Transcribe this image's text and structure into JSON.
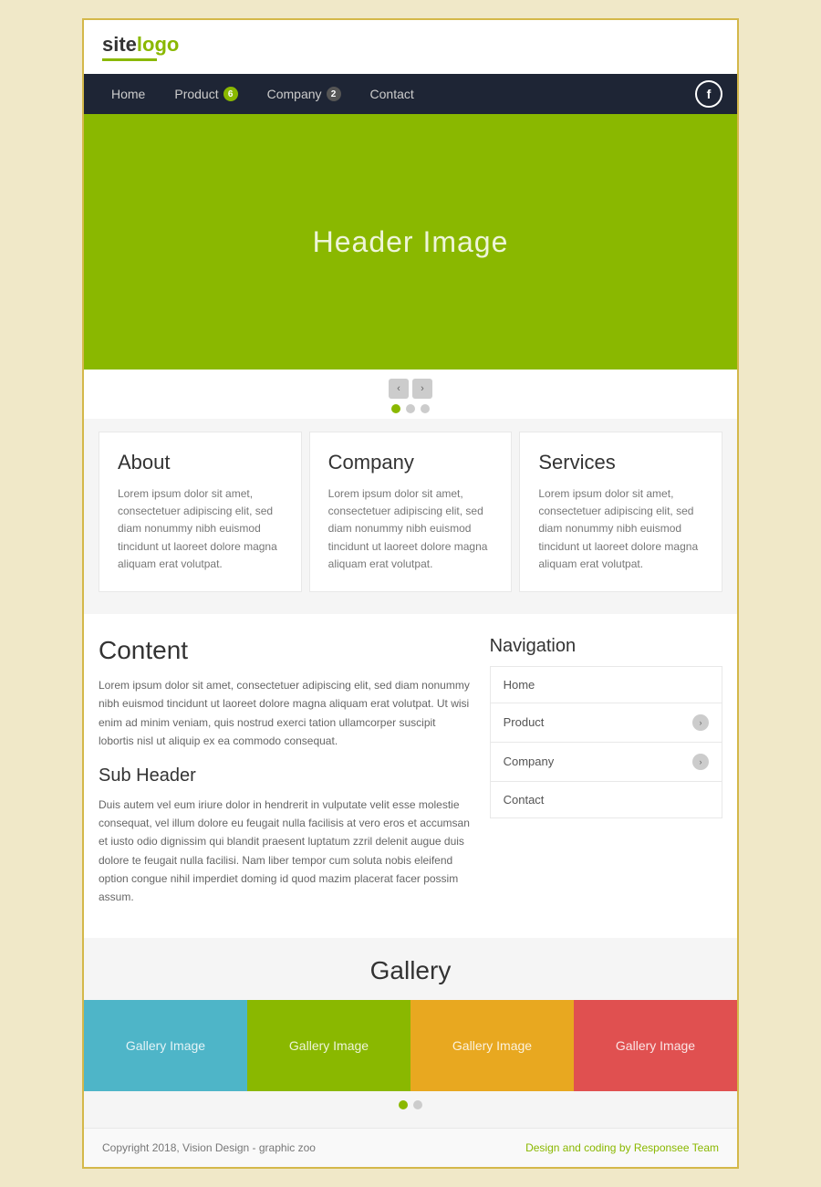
{
  "logo": {
    "text_site": "site",
    "text_logo": "logo",
    "underline": true
  },
  "nav": {
    "items": [
      {
        "label": "Home",
        "badge": null
      },
      {
        "label": "Product",
        "badge": "6"
      },
      {
        "label": "Company",
        "badge": "2"
      },
      {
        "label": "Contact",
        "badge": null
      }
    ],
    "facebook_icon": "f"
  },
  "hero": {
    "title": "Header Image"
  },
  "carousel": {
    "prev_label": "‹",
    "next_label": "›",
    "dots": [
      true,
      false,
      false
    ]
  },
  "cards": [
    {
      "title": "About",
      "body": "Lorem ipsum dolor sit amet, consectetuer adipiscing elit, sed diam nonummy nibh euismod tincidunt ut laoreet dolore magna aliquam erat volutpat."
    },
    {
      "title": "Company",
      "body": "Lorem ipsum dolor sit amet, consectetuer adipiscing elit, sed diam nonummy nibh euismod tincidunt ut laoreet dolore magna aliquam erat volutpat."
    },
    {
      "title": "Services",
      "body": "Lorem ipsum dolor sit amet, consectetuer adipiscing elit, sed diam nonummy nibh euismod tincidunt ut laoreet dolore magna aliquam erat volutpat."
    }
  ],
  "content": {
    "title": "Content",
    "body": "Lorem ipsum dolor sit amet, consectetuer adipiscing elit, sed diam nonummy nibh euismod tincidunt ut laoreet dolore magna aliquam erat volutpat. Ut wisi enim ad minim veniam, quis nostrud exerci tation ullamcorper suscipit lobortis nisl ut aliquip ex ea commodo consequat.",
    "sub_header": "Sub Header",
    "sub_body": "Duis autem vel eum iriure dolor in hendrerit in vulputate velit esse molestie consequat, vel illum dolore eu feugait nulla facilisis at vero eros et accumsan et iusto odio dignissim qui blandit praesent luptatum zzril delenit augue duis dolore te feugait nulla facilisi. Nam liber tempor cum soluta nobis eleifend option congue nihil imperdiet doming id quod mazim placerat facer possim assum."
  },
  "sidebar": {
    "title": "Navigation",
    "items": [
      {
        "label": "Home",
        "arrow": false
      },
      {
        "label": "Product",
        "arrow": true
      },
      {
        "label": "Company",
        "arrow": true
      },
      {
        "label": "Contact",
        "arrow": false
      }
    ]
  },
  "gallery": {
    "title": "Gallery",
    "items": [
      {
        "label": "Gallery Image",
        "color": "blue"
      },
      {
        "label": "Gallery Image",
        "color": "olive"
      },
      {
        "label": "Gallery Image",
        "color": "orange"
      },
      {
        "label": "Gallery Image",
        "color": "red"
      }
    ],
    "dots": [
      true,
      false
    ]
  },
  "footer": {
    "copy": "Copyright 2018, Vision Design - graphic zoo",
    "credit": "Design and coding by Responsee Team"
  }
}
